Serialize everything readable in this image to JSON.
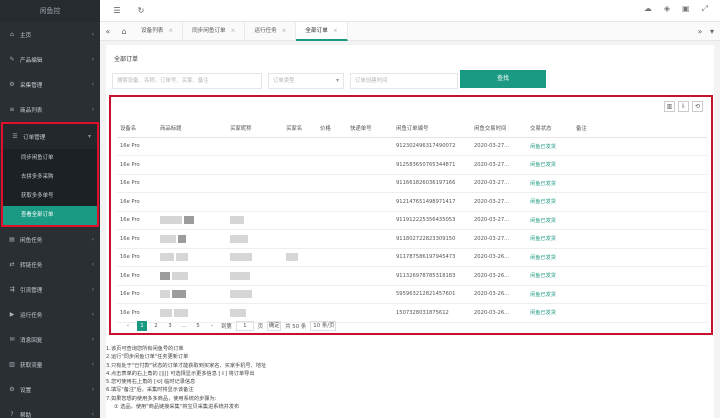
{
  "sidebar": {
    "logo": "闲鱼控",
    "items": [
      {
        "label": "主页",
        "icon": "home-icon",
        "arrow": "‹"
      },
      {
        "label": "产品编辑",
        "icon": "edit-icon",
        "arrow": "‹"
      },
      {
        "label": "采集管理",
        "icon": "gear-icon",
        "arrow": "‹"
      },
      {
        "label": "商品列表",
        "icon": "list-icon",
        "arrow": "‹"
      }
    ],
    "group": {
      "label": "订单管理",
      "icon": "cart-icon",
      "arrow": "▾",
      "subs": [
        "同步闲鱼订单",
        "去拼多多采购",
        "获取多多单号",
        "查看全部订单"
      ]
    },
    "items2": [
      {
        "label": "闲鱼任务",
        "icon": "task-icon",
        "arrow": "‹"
      },
      {
        "label": "转链任务",
        "icon": "link-icon",
        "arrow": "‹"
      },
      {
        "label": "引流管理",
        "icon": "flow-icon",
        "arrow": "‹"
      },
      {
        "label": "运行任务",
        "icon": "play-icon",
        "arrow": "‹"
      },
      {
        "label": "消息回复",
        "icon": "chat-icon",
        "arrow": "‹"
      },
      {
        "label": "获取流量",
        "icon": "chart-icon",
        "arrow": "‹"
      },
      {
        "label": "设置",
        "icon": "settings-icon",
        "arrow": "‹"
      },
      {
        "label": "帮助",
        "icon": "help-icon",
        "arrow": "‹"
      }
    ]
  },
  "tabs": [
    {
      "label": "设备列表"
    },
    {
      "label": "同步闲鱼订单"
    },
    {
      "label": "运行任务"
    },
    {
      "label": "全部订单"
    }
  ],
  "panel": {
    "title": "全部订单",
    "filter_keyword_placeholder": "搜索设备、名称、订单号、买家、备注",
    "filter_type_placeholder": "订单类型",
    "filter_date_placeholder": "订单创建时间",
    "search_label": "查找"
  },
  "table": {
    "headers": [
      "设备名",
      "商品标题",
      "买家昵称",
      "买家名",
      "价格",
      "快递单号",
      "闲鱼订单编号",
      "闲鱼交易时间",
      "交易状态",
      "备注"
    ],
    "rows": [
      {
        "device": "16e Pro",
        "order": "912302496317490072",
        "time": "2020-03-27...",
        "status": "闲鱼已发货"
      },
      {
        "device": "16e Pro",
        "order": "912583650765344871",
        "time": "2020-03-27...",
        "status": "闲鱼已发货"
      },
      {
        "device": "16e Pro",
        "order": "911661826036197166",
        "time": "2020-03-27...",
        "status": "闲鱼已发货"
      },
      {
        "device": "16e Pro",
        "order": "912147651498971417",
        "time": "2020-03-27...",
        "status": "闲鱼已发货"
      },
      {
        "device": "16e Pro",
        "order": "911912225356435053",
        "time": "2020-03-27...",
        "status": "闲鱼已发货"
      },
      {
        "device": "16e Pro",
        "order": "911802722823309150",
        "time": "2020-03-27...",
        "status": "闲鱼已发货"
      },
      {
        "device": "16e Pro",
        "order": "911787586197945473",
        "time": "2020-03-26...",
        "status": "闲鱼已发货"
      },
      {
        "device": "16e Pro",
        "order": "911326978785318183",
        "time": "2020-03-26...",
        "status": "闲鱼已发货"
      },
      {
        "device": "16e Pro",
        "order": "595963212821457601",
        "time": "2020-03-26...",
        "status": "闲鱼已发货"
      },
      {
        "device": "16e Pro",
        "order": "1507328031875612",
        "time": "2020-03-26...",
        "status": "闲鱼已发货"
      }
    ]
  },
  "pager": {
    "pages": [
      "1",
      "2",
      "3",
      "...",
      "5"
    ],
    "goto_label": "到第",
    "goto_value": "1",
    "page_unit": "页",
    "confirm": "确定",
    "total": "共 50 条",
    "per_page": "10 条/页"
  },
  "notes": [
    "1.该页可查询您所有闲鱼号的订单",
    "2.运行\"同步闲鱼订单\"任务更新订单",
    "3.只有处于\"已付款\"状态的订单才能获取到买家名、买家手机号、地址",
    "4.点击表单的右上角的 [|||] 可选择显示更多信息 [⇩] 将订单导出",
    "5.您可使用右上角的 [⟲] 临时记录信息",
    "6.填写\"备注\"后，采集时将显示该备注",
    "7.如果您想的使用多多商品，使用系统的步骤为:",
    "① 选品，使用\"商品链接采集\"将宝贝采集进系统并发布"
  ]
}
